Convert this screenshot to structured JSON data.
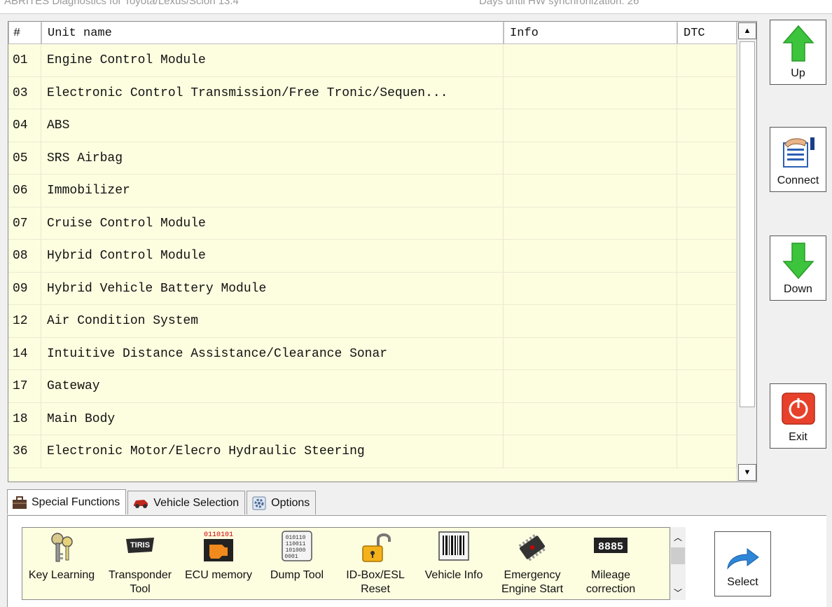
{
  "titlebar": {
    "app_title": "ABRITES Diagnostics for Toyota/Lexus/Scion 13.4",
    "hw_sync": "Days until HW synchronization: 26"
  },
  "table": {
    "columns": [
      "#",
      "Unit name",
      "Info",
      "DTC"
    ],
    "rows": [
      {
        "num": "01",
        "name": "Engine Control Module",
        "info": "",
        "dtc": ""
      },
      {
        "num": "03",
        "name": "Electronic Control Transmission/Free Tronic/Sequen...",
        "info": "",
        "dtc": ""
      },
      {
        "num": "04",
        "name": "ABS",
        "info": "",
        "dtc": ""
      },
      {
        "num": "05",
        "name": "SRS Airbag",
        "info": "",
        "dtc": ""
      },
      {
        "num": "06",
        "name": "Immobilizer",
        "info": "",
        "dtc": ""
      },
      {
        "num": "07",
        "name": "Cruise Control Module",
        "info": "",
        "dtc": ""
      },
      {
        "num": "08",
        "name": "Hybrid Control Module",
        "info": "",
        "dtc": ""
      },
      {
        "num": "09",
        "name": "Hybrid Vehicle Battery Module",
        "info": "",
        "dtc": ""
      },
      {
        "num": "12",
        "name": "Air Condition System",
        "info": "",
        "dtc": ""
      },
      {
        "num": "14",
        "name": "Intuitive Distance Assistance/Clearance Sonar",
        "info": "",
        "dtc": ""
      },
      {
        "num": "17",
        "name": "Gateway",
        "info": "",
        "dtc": ""
      },
      {
        "num": "18",
        "name": "Main Body",
        "info": "",
        "dtc": ""
      },
      {
        "num": "36",
        "name": "Electronic Motor/Elecro Hydraulic Steering",
        "info": "",
        "dtc": ""
      }
    ]
  },
  "side_buttons": {
    "up": "Up",
    "connect": "Connect",
    "down": "Down",
    "exit": "Exit"
  },
  "tabs": [
    {
      "label": "Special Functions",
      "icon": "toolbox-icon",
      "active": true
    },
    {
      "label": "Vehicle Selection",
      "icon": "car-icon",
      "active": false
    },
    {
      "label": "Options",
      "icon": "options-gear-icon",
      "active": false
    }
  ],
  "functions": [
    {
      "label": "Key Learning",
      "icon": "keys-icon"
    },
    {
      "label": "Transponder Tool",
      "icon": "transponder-icon"
    },
    {
      "label": "ECU memory",
      "icon": "ecu-memory-icon",
      "icon_text": "0110101"
    },
    {
      "label": "Dump Tool",
      "icon": "dump-tool-icon",
      "icon_text": "010110 110011 101000 0001"
    },
    {
      "label": "ID-Box/ESL Reset",
      "icon": "padlock-icon"
    },
    {
      "label": "Vehicle Info",
      "icon": "barcode-icon"
    },
    {
      "label": "Emergency Engine Start",
      "icon": "chip-icon"
    },
    {
      "label": "Mileage correction",
      "icon": "odometer-icon",
      "icon_text": "8885"
    }
  ],
  "select_button": "Select",
  "colors": {
    "list_bg": "#fdfde0",
    "arrow_green": "#3cc43c",
    "exit_red": "#e8412b",
    "select_blue": "#2e86d8"
  }
}
